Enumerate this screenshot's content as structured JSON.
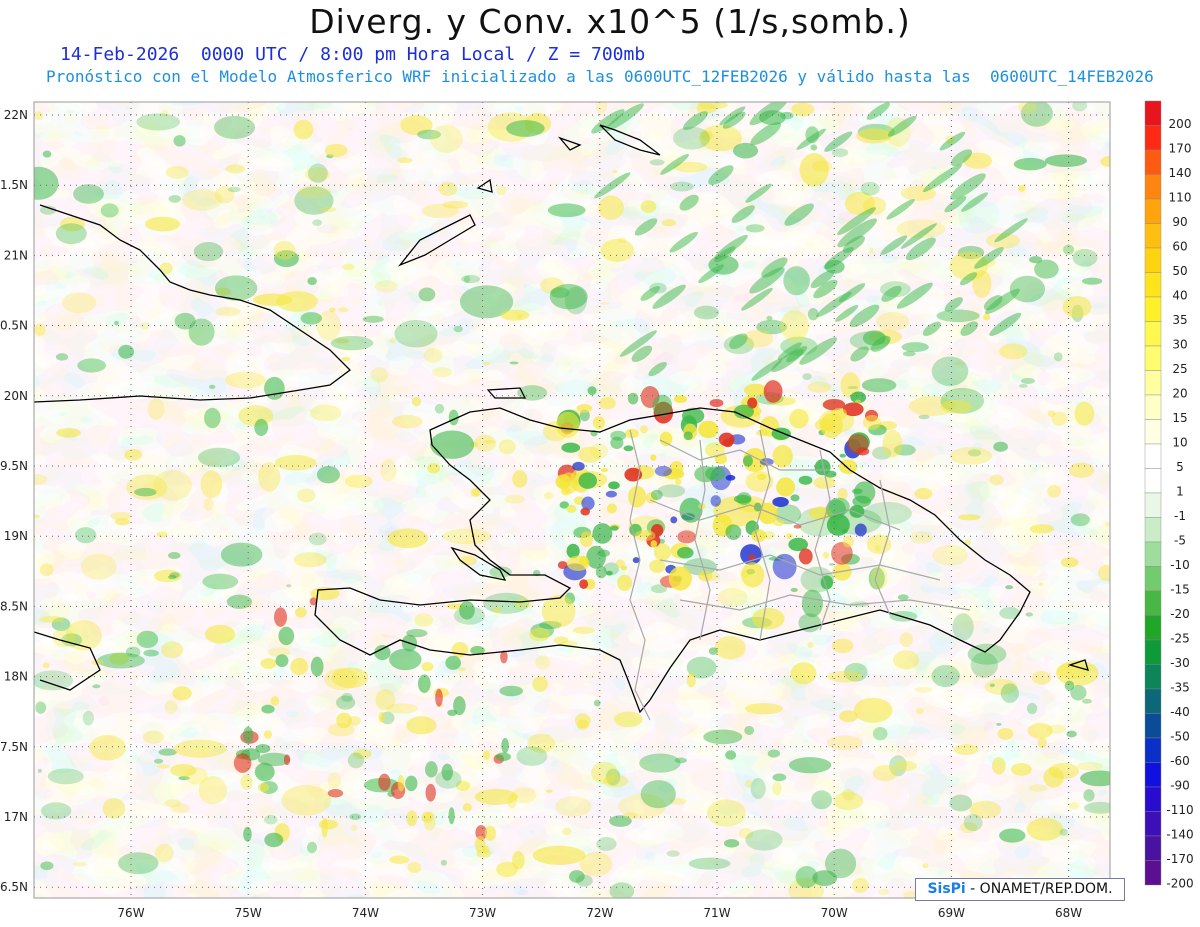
{
  "title": "Diverg. y Conv. x10^5 (1/s,somb.)",
  "subtitle_line1": "14-Feb-2026  0000 UTC / 8:00 pm Hora Local / Z = 700mb",
  "subtitle_line2": "Pronóstico con el Modelo Atmosferico WRF inicializado a las 0600UTC_12FEB2026 y válido hasta las  0600UTC_14FEB2026",
  "credit": {
    "logo": "SisPi",
    "text": "- ONAMET/REP.DOM."
  },
  "map": {
    "lon_range": [
      -76.6,
      -67.6
    ],
    "lat_range": [
      16.5,
      22.05
    ],
    "lat_labels": [
      "22N",
      "1.5N",
      "21N",
      "0.5N",
      "20N",
      "9.5N",
      "19N",
      "8.5N",
      "18N",
      "7.5N",
      "17N",
      "6.5N"
    ],
    "lon_labels": [
      "76W",
      "75W",
      "74W",
      "73W",
      "72W",
      "71W",
      "70W",
      "69W",
      "68W"
    ],
    "field_colors": {
      "positive": "#f5e63a",
      "strong_positive": "#e03020",
      "negative": "#3cb84a",
      "strong_negative": "#1a2fd0"
    }
  },
  "colorbar": {
    "labels": [
      "200",
      "170",
      "140",
      "110",
      "90",
      "60",
      "50",
      "40",
      "35",
      "30",
      "25",
      "20",
      "15",
      "10",
      "5",
      "1",
      "-1",
      "-5",
      "-10",
      "-15",
      "-20",
      "-25",
      "-30",
      "-35",
      "-40",
      "-50",
      "-60",
      "-90",
      "-110",
      "-140",
      "-170",
      "-200"
    ],
    "colors": [
      "#e8141e",
      "#ff2a14",
      "#ff5a12",
      "#ff8410",
      "#ffa40c",
      "#ffbf10",
      "#ffd310",
      "#ffe31c",
      "#fff02c",
      "#fff850",
      "#fffc70",
      "#ffffa0",
      "#ffffc8",
      "#ffffe4",
      "#ffffff",
      "#ffffff",
      "#e9f7e6",
      "#c9edc7",
      "#9fdd9c",
      "#72cb6c",
      "#47b843",
      "#21a628",
      "#0e9a3a",
      "#0c8658",
      "#0a6878",
      "#0a4c98",
      "#0a30c8",
      "#1010e0",
      "#2a0cd0",
      "#3c10b8",
      "#4a12a0",
      "#5a1090"
    ]
  }
}
